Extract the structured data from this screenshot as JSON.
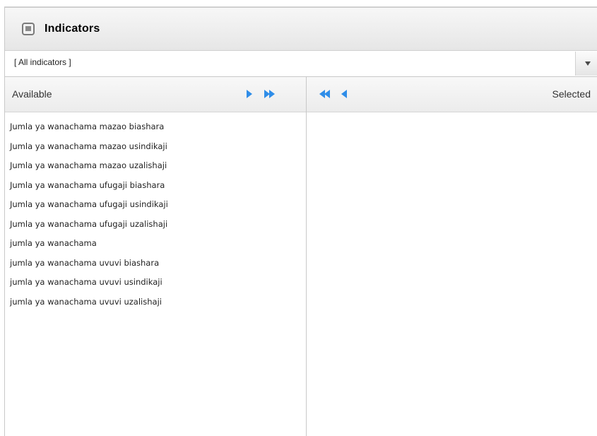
{
  "panel": {
    "title": "Indicators",
    "select_value": "[ All indicators ]",
    "available_label": "Available",
    "selected_label": "Selected",
    "icons": {
      "header": "window-icon",
      "dropdown": "chevron-down-icon",
      "move_right": "arrow-right-icon",
      "move_all_right": "double-arrow-right-icon",
      "move_all_left": "double-arrow-left-icon",
      "move_left": "arrow-left-icon"
    }
  },
  "available_items": [
    "Jumla ya wanachama mazao biashara",
    "Jumla ya wanachama mazao usindikaji",
    "Jumla ya wanachama mazao uzalishaji",
    "Jumla ya wanachama ufugaji biashara",
    "Jumla ya wanachama ufugaji usindikaji",
    "Jumla ya wanachama ufugaji uzalishaji",
    "jumla ya wanachama",
    "jumla ya wanachama uvuvi biashara",
    "jumla ya wanachama uvuvi usindikaji",
    "jumla ya wanachama uvuvi uzalishaji"
  ],
  "selected_items": [],
  "colors": {
    "accent_blue": "#2f8de8",
    "header_bg": "#ececec",
    "border": "#c8c8c8"
  }
}
